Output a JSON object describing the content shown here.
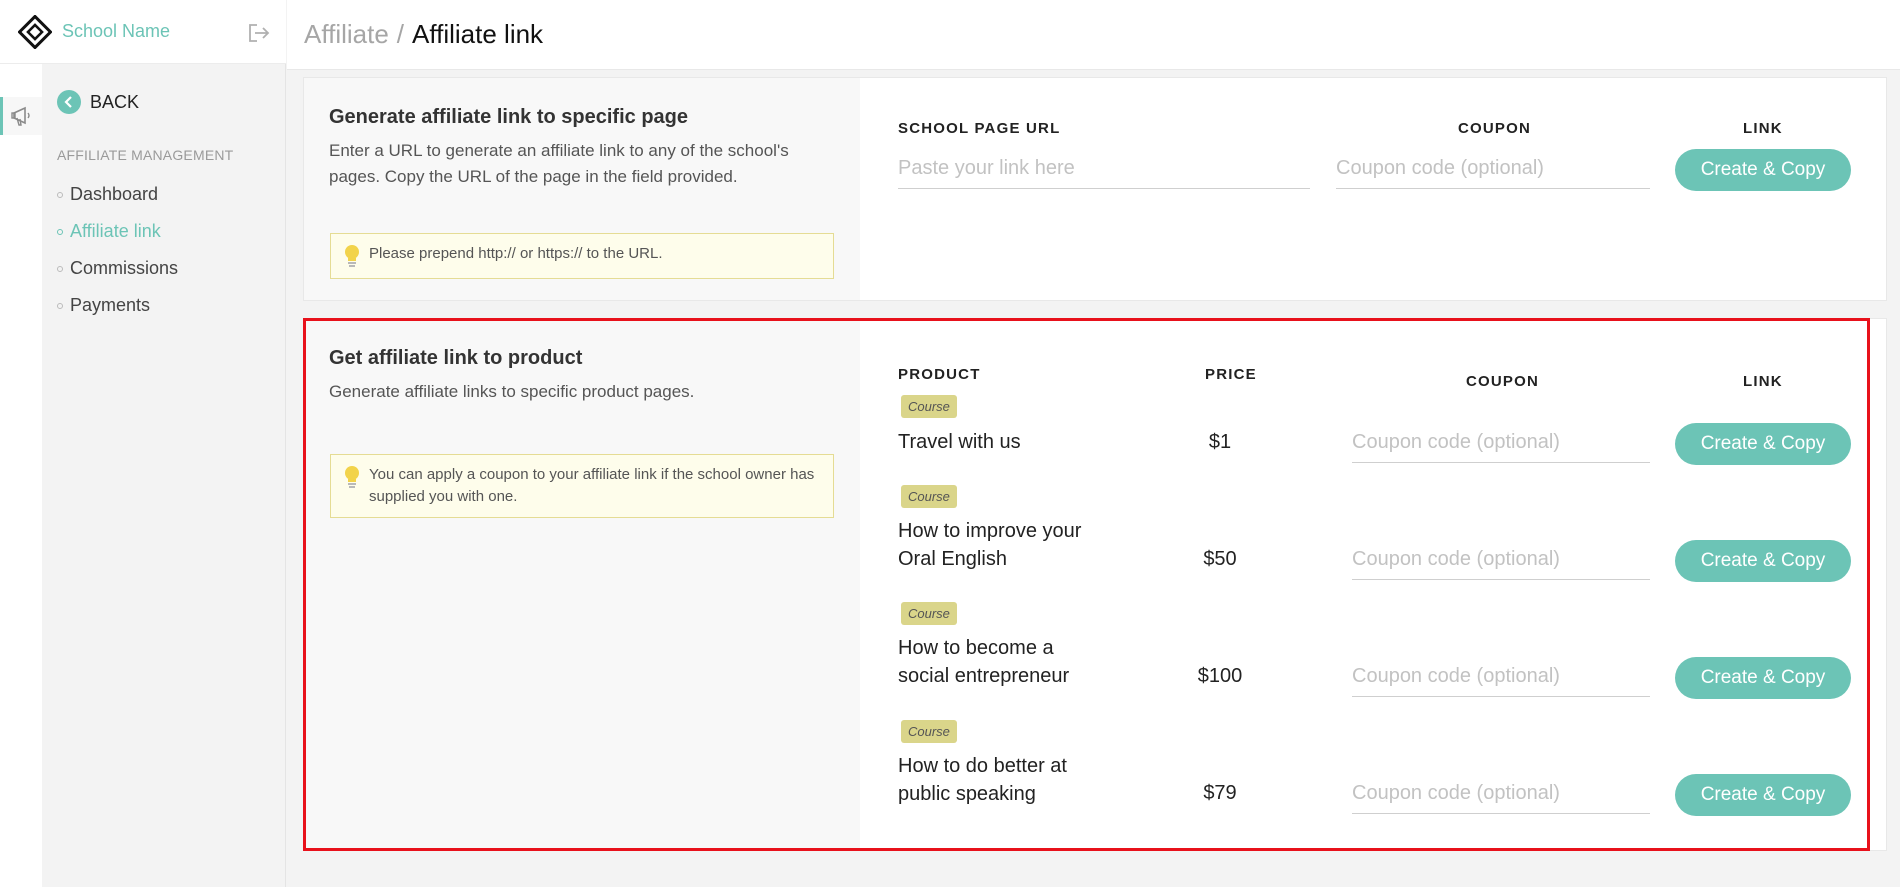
{
  "brand": {
    "school_name": "School Name",
    "logo_icon": "diamond-logo-icon",
    "logout_icon": "logout-icon"
  },
  "rail": {
    "active_icon": "megaphone-icon"
  },
  "sidebar": {
    "back_label": "BACK",
    "section_title": "AFFILIATE MANAGEMENT",
    "items": [
      {
        "label": "Dashboard",
        "active": false
      },
      {
        "label": "Affiliate link",
        "active": true
      },
      {
        "label": "Commissions",
        "active": false
      },
      {
        "label": "Payments",
        "active": false
      }
    ]
  },
  "header": {
    "parent": "Affiliate",
    "separator": "/",
    "current": "Affiliate link"
  },
  "page_link": {
    "title": "Generate affiliate link to specific page",
    "description": "Enter a URL to generate an affiliate link to any of the school's pages. Copy the URL of the page in the field provided.",
    "tip": "Please prepend http:// or https:// to the URL.",
    "col_url": "SCHOOL PAGE URL",
    "col_coupon": "COUPON",
    "col_link": "LINK",
    "url_placeholder": "Paste your link here",
    "coupon_placeholder": "Coupon code (optional)",
    "button": "Create & Copy"
  },
  "product_link": {
    "title": "Get affiliate link to product",
    "description": "Generate affiliate links to specific product pages.",
    "tip": "You can apply a coupon to your affiliate link if the school owner has supplied you with one.",
    "col_product": "PRODUCT",
    "col_price": "PRICE",
    "col_coupon": "COUPON",
    "col_link": "LINK",
    "coupon_placeholder": "Coupon code (optional)",
    "button": "Create & Copy",
    "products": [
      {
        "badge": "Course",
        "line1": "Travel with us",
        "line2": "",
        "price": "$1"
      },
      {
        "badge": "Course",
        "line1": "How to improve your",
        "line2": "Oral English",
        "price": "$50"
      },
      {
        "badge": "Course",
        "line1": "How to become a",
        "line2": "social entrepreneur",
        "price": "$100"
      },
      {
        "badge": "Course",
        "line1": "How to do better at",
        "line2": "public speaking",
        "price": "$79"
      }
    ]
  },
  "colors": {
    "accent": "#6cc4b6",
    "badge": "#dad58a",
    "tip_bg": "#fefdeb",
    "highlight": "#e8111b"
  }
}
